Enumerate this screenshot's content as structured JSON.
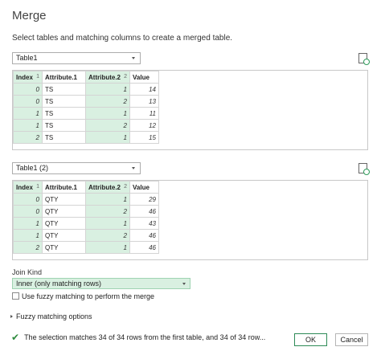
{
  "dialog": {
    "title": "Merge",
    "subtitle": "Select tables and matching columns to create a merged table."
  },
  "table1": {
    "selected": "Table1",
    "columns": [
      {
        "label": "Index",
        "num": "1",
        "selected": true
      },
      {
        "label": "Attribute.1",
        "num": "",
        "selected": false
      },
      {
        "label": "Attribute.2",
        "num": "2",
        "selected": true
      },
      {
        "label": "Value",
        "num": "",
        "selected": false
      }
    ],
    "rows": [
      [
        "0",
        "TS",
        "1",
        "14"
      ],
      [
        "0",
        "TS",
        "2",
        "13"
      ],
      [
        "1",
        "TS",
        "1",
        "11"
      ],
      [
        "1",
        "TS",
        "2",
        "12"
      ],
      [
        "2",
        "TS",
        "1",
        "15"
      ]
    ]
  },
  "table2": {
    "selected": "Table1 (2)",
    "columns": [
      {
        "label": "Index",
        "num": "1",
        "selected": true
      },
      {
        "label": "Attribute.1",
        "num": "",
        "selected": false
      },
      {
        "label": "Attribute.2",
        "num": "2",
        "selected": true
      },
      {
        "label": "Value",
        "num": "",
        "selected": false
      }
    ],
    "rows": [
      [
        "0",
        "QTY",
        "1",
        "29"
      ],
      [
        "0",
        "QTY",
        "2",
        "46"
      ],
      [
        "1",
        "QTY",
        "1",
        "43"
      ],
      [
        "1",
        "QTY",
        "2",
        "46"
      ],
      [
        "2",
        "QTY",
        "1",
        "46"
      ]
    ]
  },
  "join": {
    "label": "Join Kind",
    "selected": "Inner (only matching rows)"
  },
  "fuzzy": {
    "checkbox_label": "Use fuzzy matching to perform the merge",
    "checked": false,
    "options_label": "Fuzzy matching options"
  },
  "status": {
    "text": "The selection matches 34 of 34 rows from the first table, and 34 of 34 row..."
  },
  "buttons": {
    "ok": "OK",
    "cancel": "Cancel"
  },
  "colors": {
    "selected_column": "#d9f0e1",
    "accent_green": "#2e8b3e"
  },
  "icons": {
    "check": "✔",
    "file_refresh": "file-refresh-icon"
  }
}
